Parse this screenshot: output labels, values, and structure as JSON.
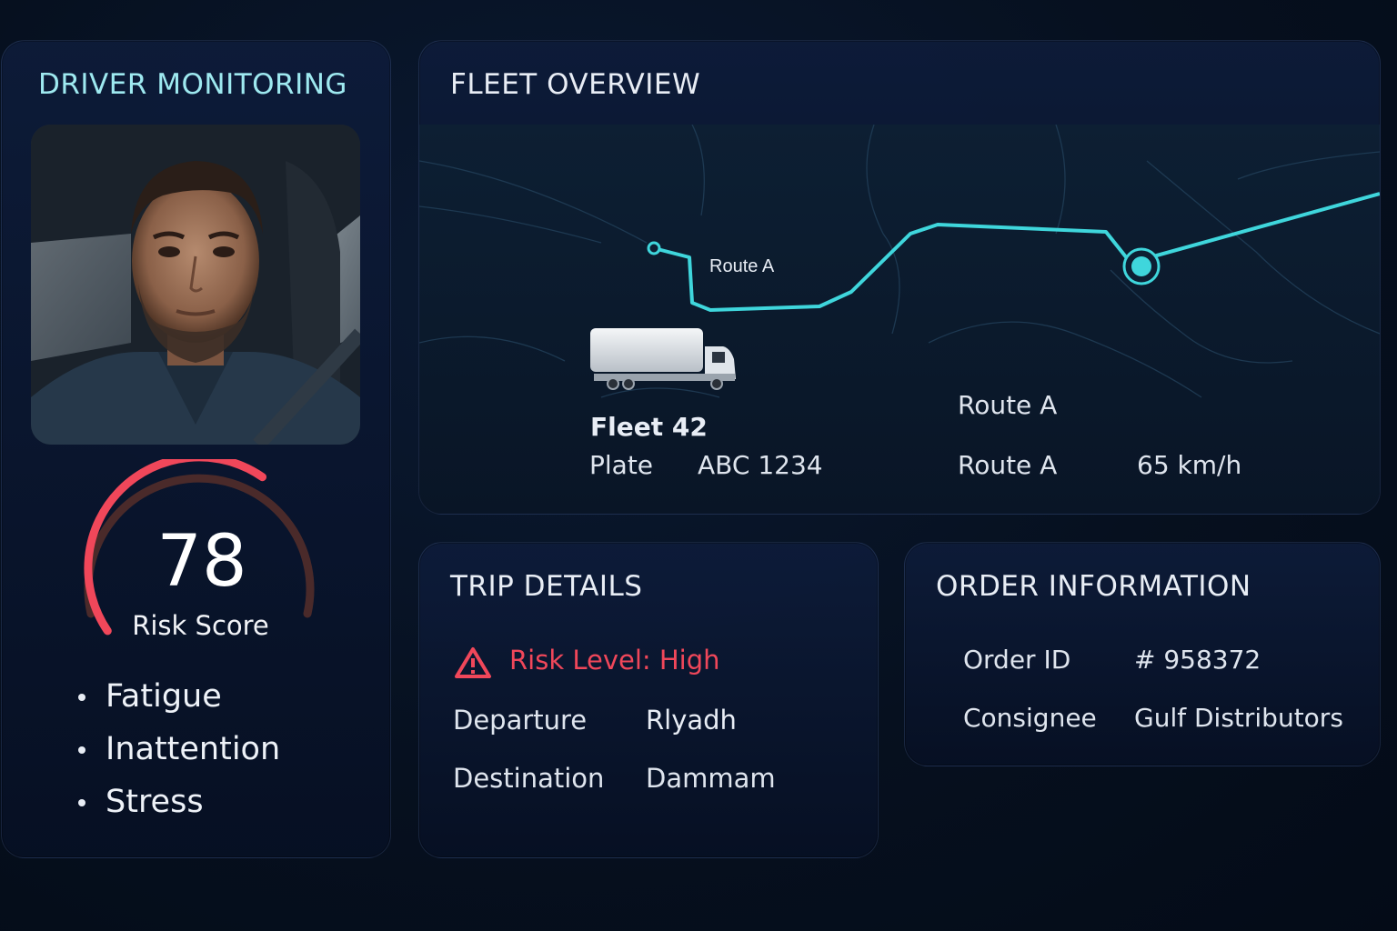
{
  "driver_monitoring": {
    "title": "DRIVER MONITORING",
    "risk_score": "78",
    "risk_score_label": "Risk Score",
    "risk_score_fraction": 0.78,
    "factors": [
      "Fatigue",
      "Inattention",
      "Stress"
    ]
  },
  "fleet_overview": {
    "title": "FLEET OVERVIEW",
    "map_route_label": "Route A",
    "vehicle_name": "Fleet 42",
    "plate_label": "Plate",
    "plate_value": "ABC 1234",
    "route_top": "Route A",
    "route_label": "Route A",
    "speed": "65 km/h"
  },
  "trip_details": {
    "title": "TRIP DETAILS",
    "risk_level": "Risk Level: High",
    "departure_label": "Departure",
    "departure_value": "Rlyadh",
    "destination_label": "Destination",
    "destination_value": "Dammam"
  },
  "order_information": {
    "title": "ORDER INFORMATION",
    "order_id_label": "Order ID",
    "order_id_value": "# 958372",
    "consignee_label": "Consignee",
    "consignee_value": "Gulf Distributors"
  },
  "colors": {
    "accent_cyan": "#3fd6dc",
    "risk_red": "#f0475a",
    "gauge_track": "#4a2a2a"
  },
  "icons": [
    "driver-photo",
    "truck-icon",
    "warning-triangle-icon",
    "route-waypoint-icon",
    "vehicle-location-icon"
  ]
}
